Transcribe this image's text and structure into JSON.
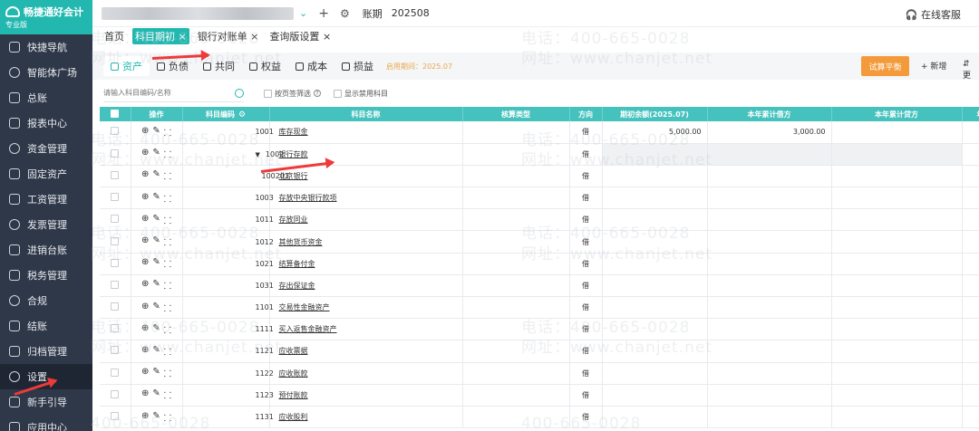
{
  "sidebar": {
    "logo_title": "畅捷通好会计",
    "logo_sub": "专业版",
    "items": [
      {
        "label": "快捷导航",
        "icon": "home-icon"
      },
      {
        "label": "智能体广场",
        "icon": "agent-icon"
      },
      {
        "label": "总账",
        "icon": "ledger-icon"
      },
      {
        "label": "报表中心",
        "icon": "report-icon"
      },
      {
        "label": "资金管理",
        "icon": "fund-icon"
      },
      {
        "label": "固定资产",
        "icon": "asset-icon"
      },
      {
        "label": "工资管理",
        "icon": "salary-icon"
      },
      {
        "label": "发票管理",
        "icon": "invoice-icon"
      },
      {
        "label": "进销台账",
        "icon": "inventory-icon"
      },
      {
        "label": "税务管理",
        "icon": "tax-icon"
      },
      {
        "label": "合规",
        "icon": "shield-icon"
      },
      {
        "label": "结账",
        "icon": "close-book-icon"
      },
      {
        "label": "归档管理",
        "icon": "archive-icon"
      },
      {
        "label": "设置",
        "icon": "gear-icon"
      },
      {
        "label": "新手引导",
        "icon": "guide-icon"
      },
      {
        "label": "应用中心",
        "icon": "apps-icon"
      }
    ]
  },
  "topbar": {
    "period_label": "账期",
    "period_value": "202508",
    "service_label": "在线客服"
  },
  "tabs": [
    {
      "label": "首页",
      "closable": false
    },
    {
      "label": "科目期初",
      "closable": true
    },
    {
      "label": "银行对账单",
      "closable": true
    },
    {
      "label": "查询版设置",
      "closable": true
    }
  ],
  "categories": [
    "资产",
    "负债",
    "共同",
    "权益",
    "成本",
    "损益"
  ],
  "enable_period": "启用期间：2025.07",
  "trial_balance_label": "试算平衡",
  "add_label": "+ 新增",
  "more_label": "⇵ 更",
  "search": {
    "placeholder": "请输入科目编码/名称"
  },
  "filters": {
    "page_filter": "按页签筛选",
    "show_disabled": "显示禁用科目"
  },
  "table": {
    "headers": [
      "操作",
      "科目编码",
      "科目名称",
      "核算类型",
      "方向",
      "期初余额(2025.07)",
      "本年累计借方",
      "本年累计贷方",
      "年"
    ],
    "rows": [
      {
        "code": "1001",
        "name": "库存现金",
        "dir": "借",
        "opening": "5,000.00",
        "debit": "3,000.00",
        "credit": "",
        "child": false,
        "expand": false
      },
      {
        "code": "1002",
        "name": "银行存款",
        "dir": "借",
        "opening": "",
        "debit": "",
        "credit": "",
        "child": false,
        "expand": true
      },
      {
        "code": "100201",
        "name": "北京银行",
        "dir": "借",
        "opening": "",
        "debit": "",
        "credit": "",
        "child": true,
        "expand": false
      },
      {
        "code": "1003",
        "name": "存放中央银行款项",
        "dir": "借",
        "opening": "",
        "debit": "",
        "credit": "",
        "child": false,
        "expand": false
      },
      {
        "code": "1011",
        "name": "存放同业",
        "dir": "借",
        "opening": "",
        "debit": "",
        "credit": "",
        "child": false,
        "expand": false
      },
      {
        "code": "1012",
        "name": "其他货币资金",
        "dir": "借",
        "opening": "",
        "debit": "",
        "credit": "",
        "child": false,
        "expand": false
      },
      {
        "code": "1021",
        "name": "结算备付金",
        "dir": "借",
        "opening": "",
        "debit": "",
        "credit": "",
        "child": false,
        "expand": false
      },
      {
        "code": "1031",
        "name": "存出保证金",
        "dir": "借",
        "opening": "",
        "debit": "",
        "credit": "",
        "child": false,
        "expand": false
      },
      {
        "code": "1101",
        "name": "交易性金融资产",
        "dir": "借",
        "opening": "",
        "debit": "",
        "credit": "",
        "child": false,
        "expand": false
      },
      {
        "code": "1111",
        "name": "买入返售金融资产",
        "dir": "借",
        "opening": "",
        "debit": "",
        "credit": "",
        "child": false,
        "expand": false
      },
      {
        "code": "1121",
        "name": "应收票据",
        "dir": "借",
        "opening": "",
        "debit": "",
        "credit": "",
        "child": false,
        "expand": false
      },
      {
        "code": "1122",
        "name": "应收账款",
        "dir": "借",
        "opening": "",
        "debit": "",
        "credit": "",
        "child": false,
        "expand": false
      },
      {
        "code": "1123",
        "name": "预付账款",
        "dir": "借",
        "opening": "",
        "debit": "",
        "credit": "",
        "child": false,
        "expand": false
      },
      {
        "code": "1131",
        "name": "应收股利",
        "dir": "借",
        "opening": "",
        "debit": "",
        "credit": "",
        "child": false,
        "expand": false
      }
    ]
  },
  "watermark": {
    "phone": "电话：400-665-0028",
    "site": "网址：www.chanjet.net",
    "partial": "400-665-0028"
  },
  "colors": {
    "accent": "#22b8b0",
    "header": "#45c2bd",
    "sidebar": "#2f3848",
    "orange": "#f39a3b",
    "arrow": "#ee3a3a"
  }
}
